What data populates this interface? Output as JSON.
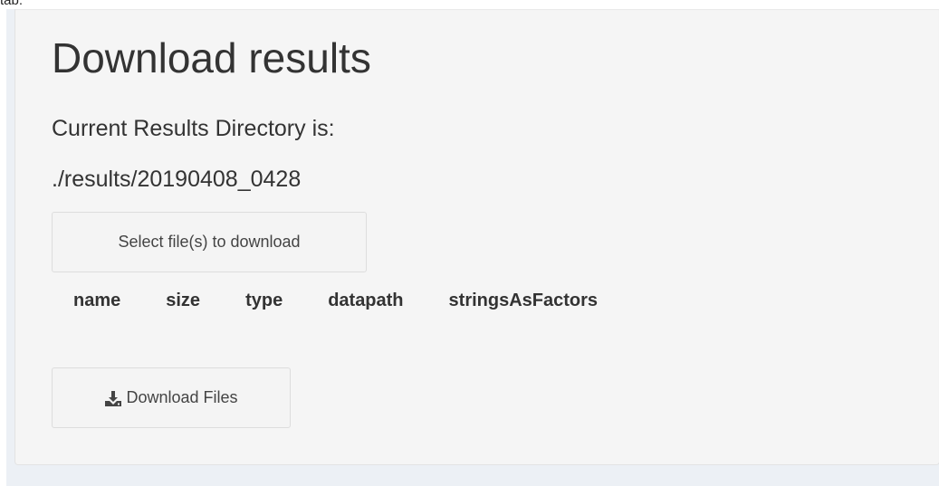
{
  "top_label": "tab:",
  "panel": {
    "title": "Download results",
    "directory_label": "Current Results Directory is:",
    "directory_path": "./results/20190408_0428"
  },
  "select_files_button": {
    "label": "Select file(s) to download"
  },
  "files_table": {
    "columns": [
      "name",
      "size",
      "type",
      "datapath",
      "stringsAsFactors"
    ]
  },
  "download_button": {
    "label": "Download Files",
    "icon": "download-icon"
  }
}
